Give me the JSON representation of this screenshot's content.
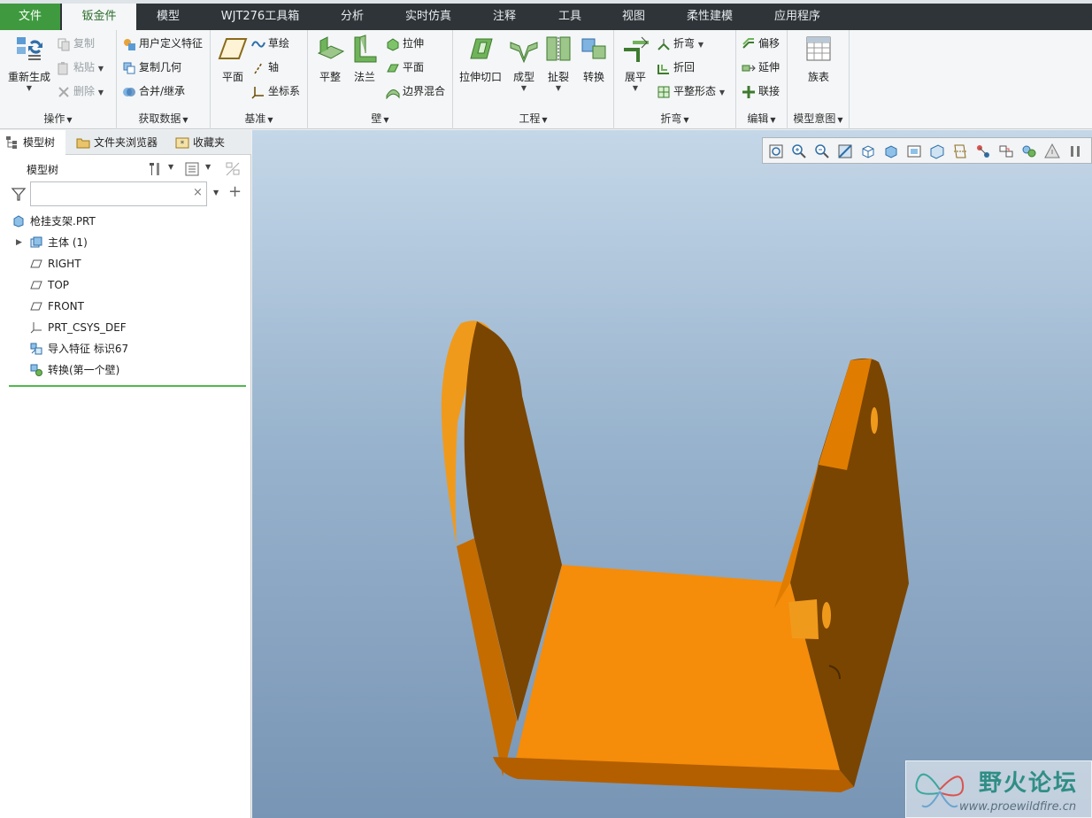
{
  "menu": {
    "tabs": [
      "文件",
      "钣金件",
      "模型",
      "WJT276工具箱",
      "分析",
      "实时仿真",
      "注释",
      "工具",
      "视图",
      "柔性建模",
      "应用程序"
    ],
    "active_tab": "钣金件"
  },
  "ribbon": {
    "operations": {
      "label": "操作",
      "regenerate": "重新生成",
      "copy": "复制",
      "paste": "粘贴",
      "delete": "删除"
    },
    "get_data": {
      "label": "获取数据",
      "udf": "用户定义特征",
      "copy_geom": "复制几何",
      "merge": "合并/继承"
    },
    "datum": {
      "label": "基准",
      "plane": "平面",
      "sketch": "草绘",
      "axis": "轴",
      "csys": "坐标系"
    },
    "wall": {
      "label": "壁",
      "flat": "平整",
      "flange": "法兰",
      "extrude": "拉伸",
      "plane": "平面",
      "blend": "边界混合"
    },
    "engineering": {
      "label": "工程",
      "extrude_cut": "拉伸切口",
      "form": "成型",
      "rip": "扯裂",
      "convert": "转换"
    },
    "bend": {
      "label": "折弯",
      "unbend": "展平",
      "bend": "折弯",
      "bend_back": "折回",
      "flat_state": "平整形态"
    },
    "edit": {
      "label": "编辑",
      "offset": "偏移",
      "extend": "延伸",
      "join": "联接"
    },
    "model_intent": {
      "label": "模型意图",
      "family_table": "族表"
    }
  },
  "panel": {
    "tabs": [
      "模型树",
      "文件夹浏览器",
      "收藏夹"
    ],
    "tree_title": "模型树",
    "search_placeholder": "",
    "items": [
      {
        "label": "枪挂支架.PRT",
        "icon": "part-icon"
      },
      {
        "label": "主体 (1)",
        "icon": "body-icon"
      },
      {
        "label": "RIGHT",
        "icon": "datum-plane-icon"
      },
      {
        "label": "TOP",
        "icon": "datum-plane-icon"
      },
      {
        "label": "FRONT",
        "icon": "datum-plane-icon"
      },
      {
        "label": "PRT_CSYS_DEF",
        "icon": "csys-icon"
      },
      {
        "label": "导入特征 标识67",
        "icon": "import-feature-icon"
      },
      {
        "label": "转换(第一个壁)",
        "icon": "convert-feature-icon"
      }
    ]
  },
  "watermark": {
    "main": "野火论坛",
    "url": "www.proewildfire.cn"
  },
  "colors": {
    "menubar": "#2e3438",
    "file_tab": "#3f9a3f",
    "part_face": "#f58c0a",
    "part_side": "#7a4500"
  }
}
